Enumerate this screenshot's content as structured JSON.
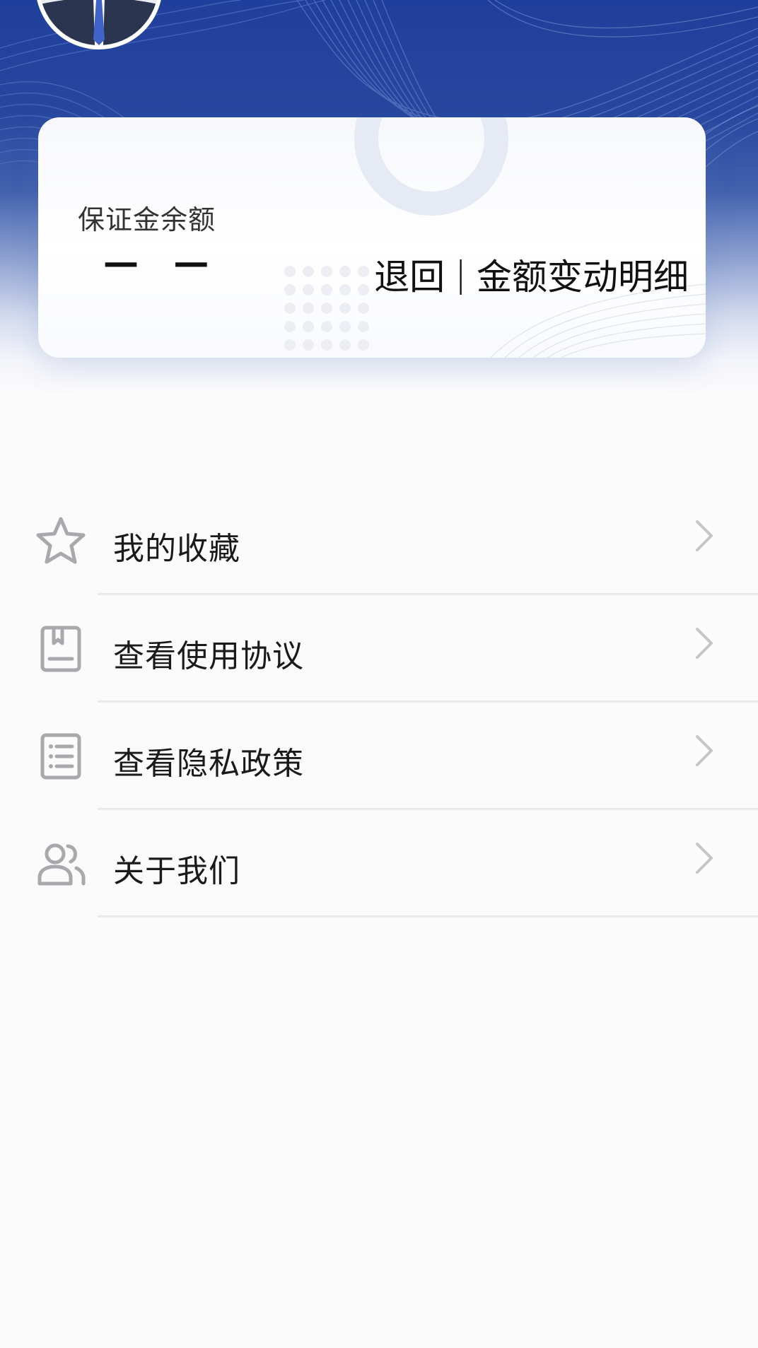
{
  "balance_card": {
    "label": "保证金余额",
    "value": "— —",
    "refund_action": "退回",
    "separator": "|",
    "details_action": "金额变动明细"
  },
  "menu": {
    "items": [
      {
        "label": "我的收藏",
        "icon": "star-icon"
      },
      {
        "label": "查看使用协议",
        "icon": "agreement-book-icon"
      },
      {
        "label": "查看隐私政策",
        "icon": "list-document-icon"
      },
      {
        "label": "关于我们",
        "icon": "users-icon"
      }
    ]
  },
  "colors": {
    "banner_blue": "#1f3f9c",
    "icon_gray": "#a7a9ad",
    "arrow_gray": "#c4c6ca",
    "divider": "#e9eaee"
  }
}
